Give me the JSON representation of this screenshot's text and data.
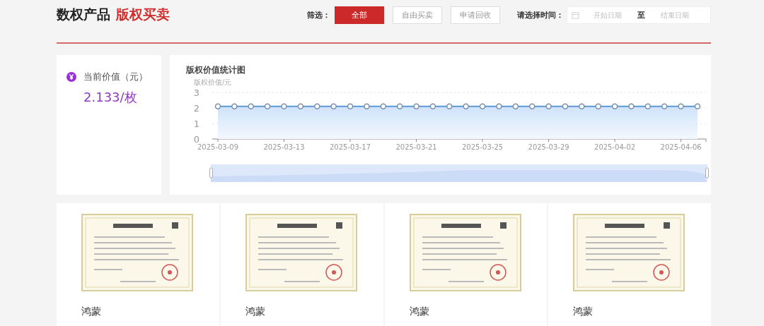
{
  "header": {
    "title": "数权产品",
    "subtitle": "版权买卖"
  },
  "filter": {
    "label": "筛选：",
    "options": [
      {
        "label": "全部",
        "selected": true
      },
      {
        "label": "自由买卖",
        "selected": false
      },
      {
        "label": "申请回收",
        "selected": false
      }
    ]
  },
  "date_range": {
    "label": "请选择时间：",
    "start_placeholder": "开始日期",
    "separator": "至",
    "end_placeholder": "结束日期"
  },
  "current_value": {
    "label": "当前价值（元）",
    "value": "2.133/枚"
  },
  "chart_panel": {
    "title": "版权价值统计图",
    "chart_data": {
      "type": "area",
      "ylabel": "版权价值/元",
      "categories": [
        "2025-03-09",
        null,
        null,
        null,
        "2025-03-13",
        null,
        null,
        null,
        "2025-03-17",
        null,
        null,
        null,
        "2025-03-21",
        null,
        null,
        null,
        "2025-03-25",
        null,
        null,
        null,
        "2025-03-29",
        null,
        null,
        null,
        "2025-04-02",
        null,
        null,
        null,
        "2025-04-06",
        null
      ],
      "series": [
        {
          "color": "#5b9bd5",
          "values": [
            2.1,
            2.1,
            2.1,
            2.1,
            2.1,
            2.1,
            2.1,
            2.1,
            2.1,
            2.1,
            2.1,
            2.1,
            2.1,
            2.1,
            2.1,
            2.1,
            2.1,
            2.1,
            2.1,
            2.1,
            2.1,
            2.1,
            2.1,
            2.1,
            2.1,
            2.1,
            2.1,
            2.1,
            2.1,
            2.1
          ]
        }
      ],
      "ylim": [
        0,
        3
      ],
      "yticks": [
        0,
        1,
        2,
        3
      ]
    }
  },
  "products": [
    {
      "name": "鸿蒙"
    },
    {
      "name": "鸿蒙"
    },
    {
      "name": "鸿蒙"
    },
    {
      "name": "鸿蒙"
    }
  ]
}
